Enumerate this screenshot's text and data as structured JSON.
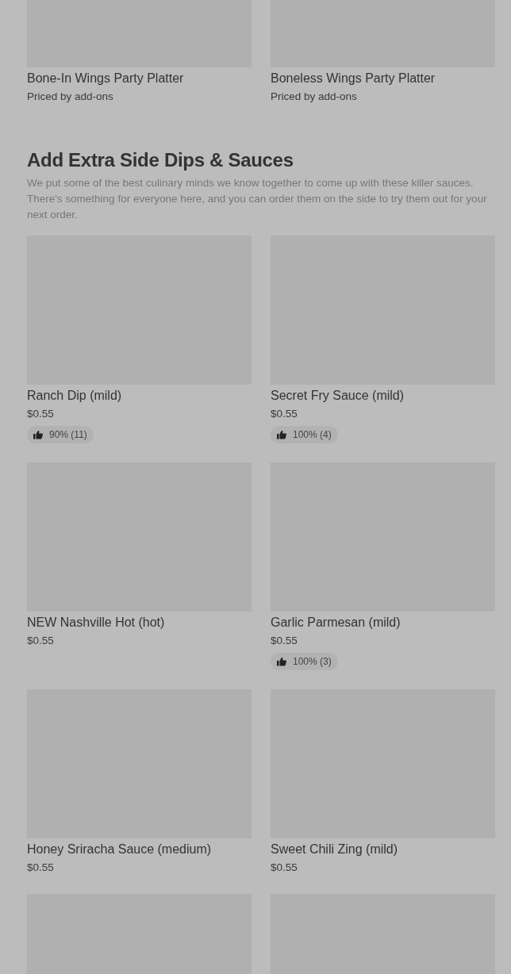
{
  "top_items": [
    {
      "name": "Bone-In Wings Party Platter",
      "subtitle": "Priced by add-ons"
    },
    {
      "name": "Boneless Wings Party Platter",
      "subtitle": "Priced by add-ons"
    }
  ],
  "section": {
    "title": "Add Extra Side Dips & Sauces",
    "description": "We put some of the best culinary minds we know together to come up with these killer sauces. There's something for everyone here, and you can order them on the side to try them out for your next order.",
    "items": [
      {
        "kind": "dish",
        "name": "Ranch Dip (mild)",
        "price": "$0.55",
        "rating": "90% (11)"
      },
      {
        "kind": "dish",
        "name": "Secret Fry Sauce (mild)",
        "price": "$0.55",
        "rating": "100% (4)"
      },
      {
        "kind": "dish",
        "name": "NEW Nashville Hot (hot)",
        "price": "$0.55"
      },
      {
        "kind": "dish",
        "name": "Garlic Parmesan (mild)",
        "price": "$0.55",
        "rating": "100% (3)"
      },
      {
        "kind": "dish",
        "name": "Honey Sriracha Sauce (medium)",
        "price": "$0.55"
      },
      {
        "kind": "dish",
        "name": "Sweet Chili Zing (mild)",
        "price": "$0.55"
      },
      {
        "kind": "image_only"
      },
      {
        "kind": "image_only"
      }
    ]
  }
}
